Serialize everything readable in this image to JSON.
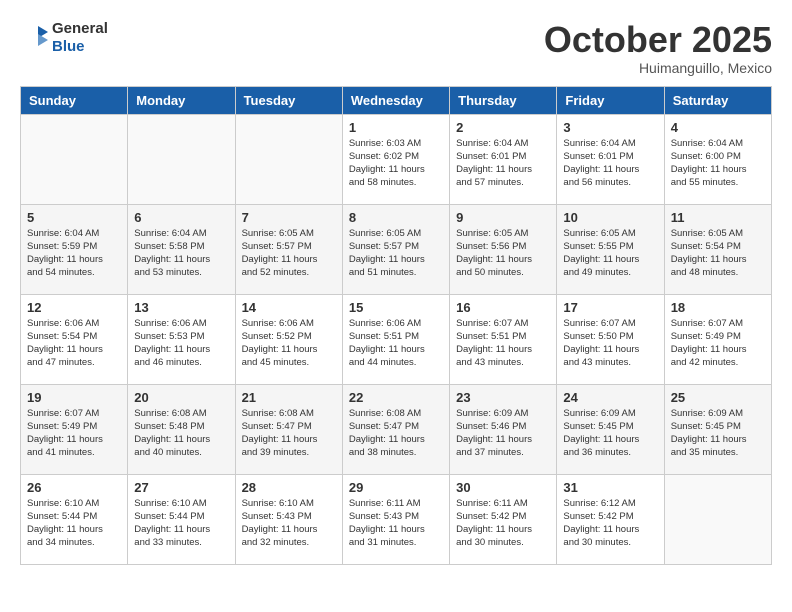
{
  "header": {
    "logo_line1": "General",
    "logo_line2": "Blue",
    "month": "October 2025",
    "location": "Huimanguillo, Mexico"
  },
  "weekdays": [
    "Sunday",
    "Monday",
    "Tuesday",
    "Wednesday",
    "Thursday",
    "Friday",
    "Saturday"
  ],
  "weeks": [
    [
      {
        "day": "",
        "info": ""
      },
      {
        "day": "",
        "info": ""
      },
      {
        "day": "",
        "info": ""
      },
      {
        "day": "1",
        "info": "Sunrise: 6:03 AM\nSunset: 6:02 PM\nDaylight: 11 hours\nand 58 minutes."
      },
      {
        "day": "2",
        "info": "Sunrise: 6:04 AM\nSunset: 6:01 PM\nDaylight: 11 hours\nand 57 minutes."
      },
      {
        "day": "3",
        "info": "Sunrise: 6:04 AM\nSunset: 6:01 PM\nDaylight: 11 hours\nand 56 minutes."
      },
      {
        "day": "4",
        "info": "Sunrise: 6:04 AM\nSunset: 6:00 PM\nDaylight: 11 hours\nand 55 minutes."
      }
    ],
    [
      {
        "day": "5",
        "info": "Sunrise: 6:04 AM\nSunset: 5:59 PM\nDaylight: 11 hours\nand 54 minutes."
      },
      {
        "day": "6",
        "info": "Sunrise: 6:04 AM\nSunset: 5:58 PM\nDaylight: 11 hours\nand 53 minutes."
      },
      {
        "day": "7",
        "info": "Sunrise: 6:05 AM\nSunset: 5:57 PM\nDaylight: 11 hours\nand 52 minutes."
      },
      {
        "day": "8",
        "info": "Sunrise: 6:05 AM\nSunset: 5:57 PM\nDaylight: 11 hours\nand 51 minutes."
      },
      {
        "day": "9",
        "info": "Sunrise: 6:05 AM\nSunset: 5:56 PM\nDaylight: 11 hours\nand 50 minutes."
      },
      {
        "day": "10",
        "info": "Sunrise: 6:05 AM\nSunset: 5:55 PM\nDaylight: 11 hours\nand 49 minutes."
      },
      {
        "day": "11",
        "info": "Sunrise: 6:05 AM\nSunset: 5:54 PM\nDaylight: 11 hours\nand 48 minutes."
      }
    ],
    [
      {
        "day": "12",
        "info": "Sunrise: 6:06 AM\nSunset: 5:54 PM\nDaylight: 11 hours\nand 47 minutes."
      },
      {
        "day": "13",
        "info": "Sunrise: 6:06 AM\nSunset: 5:53 PM\nDaylight: 11 hours\nand 46 minutes."
      },
      {
        "day": "14",
        "info": "Sunrise: 6:06 AM\nSunset: 5:52 PM\nDaylight: 11 hours\nand 45 minutes."
      },
      {
        "day": "15",
        "info": "Sunrise: 6:06 AM\nSunset: 5:51 PM\nDaylight: 11 hours\nand 44 minutes."
      },
      {
        "day": "16",
        "info": "Sunrise: 6:07 AM\nSunset: 5:51 PM\nDaylight: 11 hours\nand 43 minutes."
      },
      {
        "day": "17",
        "info": "Sunrise: 6:07 AM\nSunset: 5:50 PM\nDaylight: 11 hours\nand 43 minutes."
      },
      {
        "day": "18",
        "info": "Sunrise: 6:07 AM\nSunset: 5:49 PM\nDaylight: 11 hours\nand 42 minutes."
      }
    ],
    [
      {
        "day": "19",
        "info": "Sunrise: 6:07 AM\nSunset: 5:49 PM\nDaylight: 11 hours\nand 41 minutes."
      },
      {
        "day": "20",
        "info": "Sunrise: 6:08 AM\nSunset: 5:48 PM\nDaylight: 11 hours\nand 40 minutes."
      },
      {
        "day": "21",
        "info": "Sunrise: 6:08 AM\nSunset: 5:47 PM\nDaylight: 11 hours\nand 39 minutes."
      },
      {
        "day": "22",
        "info": "Sunrise: 6:08 AM\nSunset: 5:47 PM\nDaylight: 11 hours\nand 38 minutes."
      },
      {
        "day": "23",
        "info": "Sunrise: 6:09 AM\nSunset: 5:46 PM\nDaylight: 11 hours\nand 37 minutes."
      },
      {
        "day": "24",
        "info": "Sunrise: 6:09 AM\nSunset: 5:45 PM\nDaylight: 11 hours\nand 36 minutes."
      },
      {
        "day": "25",
        "info": "Sunrise: 6:09 AM\nSunset: 5:45 PM\nDaylight: 11 hours\nand 35 minutes."
      }
    ],
    [
      {
        "day": "26",
        "info": "Sunrise: 6:10 AM\nSunset: 5:44 PM\nDaylight: 11 hours\nand 34 minutes."
      },
      {
        "day": "27",
        "info": "Sunrise: 6:10 AM\nSunset: 5:44 PM\nDaylight: 11 hours\nand 33 minutes."
      },
      {
        "day": "28",
        "info": "Sunrise: 6:10 AM\nSunset: 5:43 PM\nDaylight: 11 hours\nand 32 minutes."
      },
      {
        "day": "29",
        "info": "Sunrise: 6:11 AM\nSunset: 5:43 PM\nDaylight: 11 hours\nand 31 minutes."
      },
      {
        "day": "30",
        "info": "Sunrise: 6:11 AM\nSunset: 5:42 PM\nDaylight: 11 hours\nand 30 minutes."
      },
      {
        "day": "31",
        "info": "Sunrise: 6:12 AM\nSunset: 5:42 PM\nDaylight: 11 hours\nand 30 minutes."
      },
      {
        "day": "",
        "info": ""
      }
    ]
  ]
}
